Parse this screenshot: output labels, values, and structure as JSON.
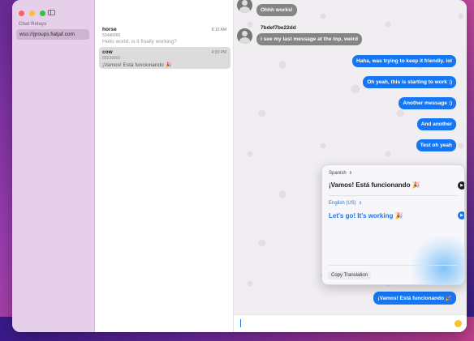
{
  "relays": {
    "heading": "Chat Relays",
    "items": [
      {
        "label": "wss://groups.fiatjaf.com"
      }
    ]
  },
  "chats": [
    {
      "name": "horse",
      "time": "8:10 AM",
      "id": "534d6666",
      "preview": "Hello world, is it finally working?",
      "selected": false
    },
    {
      "name": "cow",
      "time": "4:39 PM",
      "id": "85536666",
      "preview": "¡Vamos! Está funcionando 🎉",
      "selected": true
    }
  ],
  "conversation": {
    "messages": [
      {
        "direction": "in",
        "text": "Ohhh works!"
      },
      {
        "direction": "in",
        "sender": "7bdef7be22dd",
        "text": "i see my last message at the top, weird"
      },
      {
        "direction": "out",
        "text": "Haha, was trying to keep it friendly. lol"
      },
      {
        "direction": "out",
        "text": "Oh yeah, this is starting to work :)"
      },
      {
        "direction": "out",
        "text": "Another message :)"
      },
      {
        "direction": "out",
        "text": "And another"
      },
      {
        "direction": "out",
        "text": "Test oh yeah"
      },
      {
        "direction": "out",
        "text": "¡Vamos! Está funcionando 🎉"
      }
    ]
  },
  "translation": {
    "source_lang": "Spanish",
    "source_text": "¡Vamos! Está funcionando 🎉",
    "target_lang": "English (US)",
    "target_text": "Let's go! It's working 🎉",
    "copy_label": "Copy Translation",
    "accent_color": "#1677f5"
  },
  "composer": {
    "emoji_icon": "emoji-icon"
  }
}
